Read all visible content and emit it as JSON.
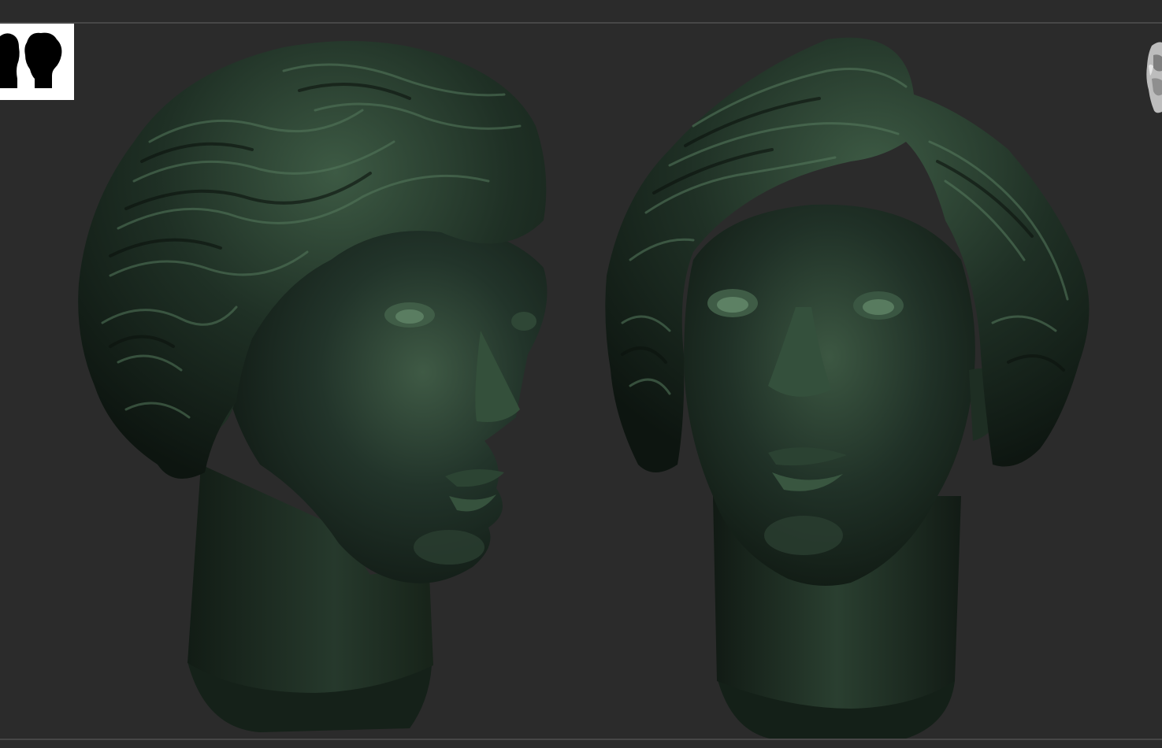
{
  "viewport": {
    "background_color": "#2b2b2b",
    "rule_color": "#474747"
  },
  "thumbnail": {
    "icon": "silhouette-thumbnail-icon",
    "background_color": "#ffffff",
    "silhouette_color": "#000000"
  },
  "nav_cube": {
    "icon": "head-navigation-icon"
  },
  "models": [
    {
      "name": "sculpted-head-three-quarter",
      "view": "three-quarter"
    },
    {
      "name": "sculpted-head-front",
      "view": "front"
    }
  ],
  "material": {
    "base_color": "#1f2e22",
    "highlight_color": "#5f8766",
    "shadow_color": "#0b120d"
  }
}
